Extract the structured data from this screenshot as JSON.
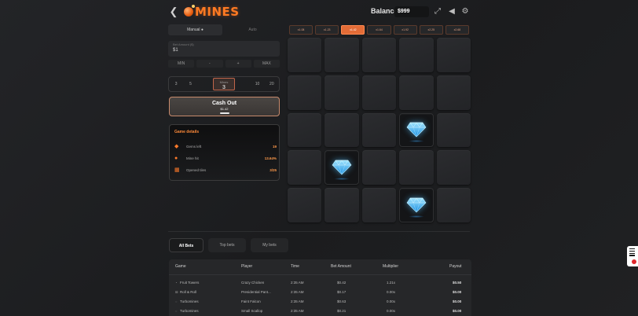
{
  "header": {
    "logo_text": "MINES",
    "balance_label": "Balance:",
    "balance_value": "$999",
    "icons": [
      "back-icon",
      "fullscreen-icon",
      "volume-icon",
      "settings-icon"
    ]
  },
  "bet_panel": {
    "tabs": [
      {
        "label": "Manual ●",
        "active": true
      },
      {
        "label": "Auto",
        "active": false
      }
    ],
    "bet_amount_label": "Bet Amount ($)",
    "bet_amount_value": "$1",
    "quick_buttons": [
      "MIN",
      "-",
      "+",
      "MAX"
    ],
    "mines_options": [
      "3",
      "5",
      "",
      "",
      "10",
      "20"
    ],
    "mines_selected": {
      "label": "Mines",
      "value": "3"
    },
    "cashout": {
      "label": "Cash Out",
      "amount": "$1.42"
    }
  },
  "game_details": {
    "title": "Game details",
    "rows": [
      {
        "icon": "gem-icon",
        "label": "Gems left",
        "value": "19"
      },
      {
        "icon": "bomb-icon",
        "label": "Mine hit",
        "value": "13.64%"
      },
      {
        "icon": "tiles-icon",
        "label": "Opened tiles",
        "value": "3/25"
      }
    ]
  },
  "multipliers": [
    {
      "label": "x1.08",
      "active": false
    },
    {
      "label": "x1.23",
      "active": false
    },
    {
      "label": "x1.42",
      "active": true
    },
    {
      "label": "x1.64",
      "active": false
    },
    {
      "label": "x1.92",
      "active": false
    },
    {
      "label": "x2.25",
      "active": false
    },
    {
      "label": "x2.68",
      "active": false
    }
  ],
  "grid": {
    "rows": 5,
    "cols": 5,
    "gems": [
      [
        2,
        3
      ],
      [
        3,
        1
      ],
      [
        4,
        3
      ]
    ]
  },
  "bets": {
    "tabs": [
      {
        "label": "All Bets",
        "active": true
      },
      {
        "label": "Top bets",
        "active": false
      },
      {
        "label": "My bets",
        "active": false
      }
    ],
    "columns": [
      "Game",
      "Player",
      "Time",
      "Bet Amount",
      "Multiplier",
      "Payout"
    ],
    "rows": [
      {
        "game": "Fruit Towers",
        "icon": "fruit-icon",
        "player": "Crazy Chicken",
        "time": "2:35 AM",
        "bet": "$0.42",
        "multiplier": "1.21x",
        "payout": "$0.50"
      },
      {
        "game": "Roll & Roll",
        "icon": "dice-icon",
        "player": "Presidential Pant...",
        "time": "2:35 AM",
        "bet": "$0.17",
        "multiplier": "0.00x",
        "payout": "$0.00"
      },
      {
        "game": "Turbomines",
        "icon": "mine-icon",
        "player": "Faint Falcon",
        "time": "2:35 AM",
        "bet": "$0.63",
        "multiplier": "0.00x",
        "payout": "$0.00"
      },
      {
        "game": "Turbomines",
        "icon": "mine-icon",
        "player": "Small Scallop",
        "time": "2:35 AM",
        "bet": "$0.21",
        "multiplier": "0.00x",
        "payout": "$0.00"
      }
    ]
  },
  "colors": {
    "accent": "#ff7a22",
    "gem": "#4fc3ff"
  }
}
